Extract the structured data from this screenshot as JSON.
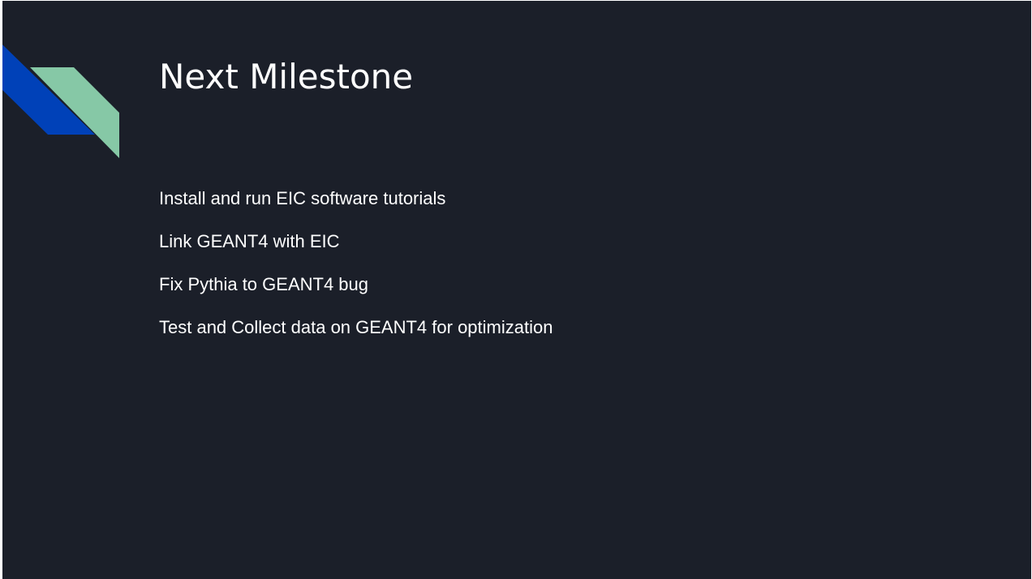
{
  "slide": {
    "title": "Next Milestone",
    "bullets": [
      "Install and run EIC software tutorials",
      "Link GEANT4 with EIC",
      "Fix Pythia to GEANT4 bug",
      "Test and Collect data on GEANT4 for optimization"
    ]
  },
  "colors": {
    "background": "#1b1f29",
    "accent_blue": "#0041b8",
    "accent_green": "#86c8a6",
    "text": "#ffffff"
  }
}
